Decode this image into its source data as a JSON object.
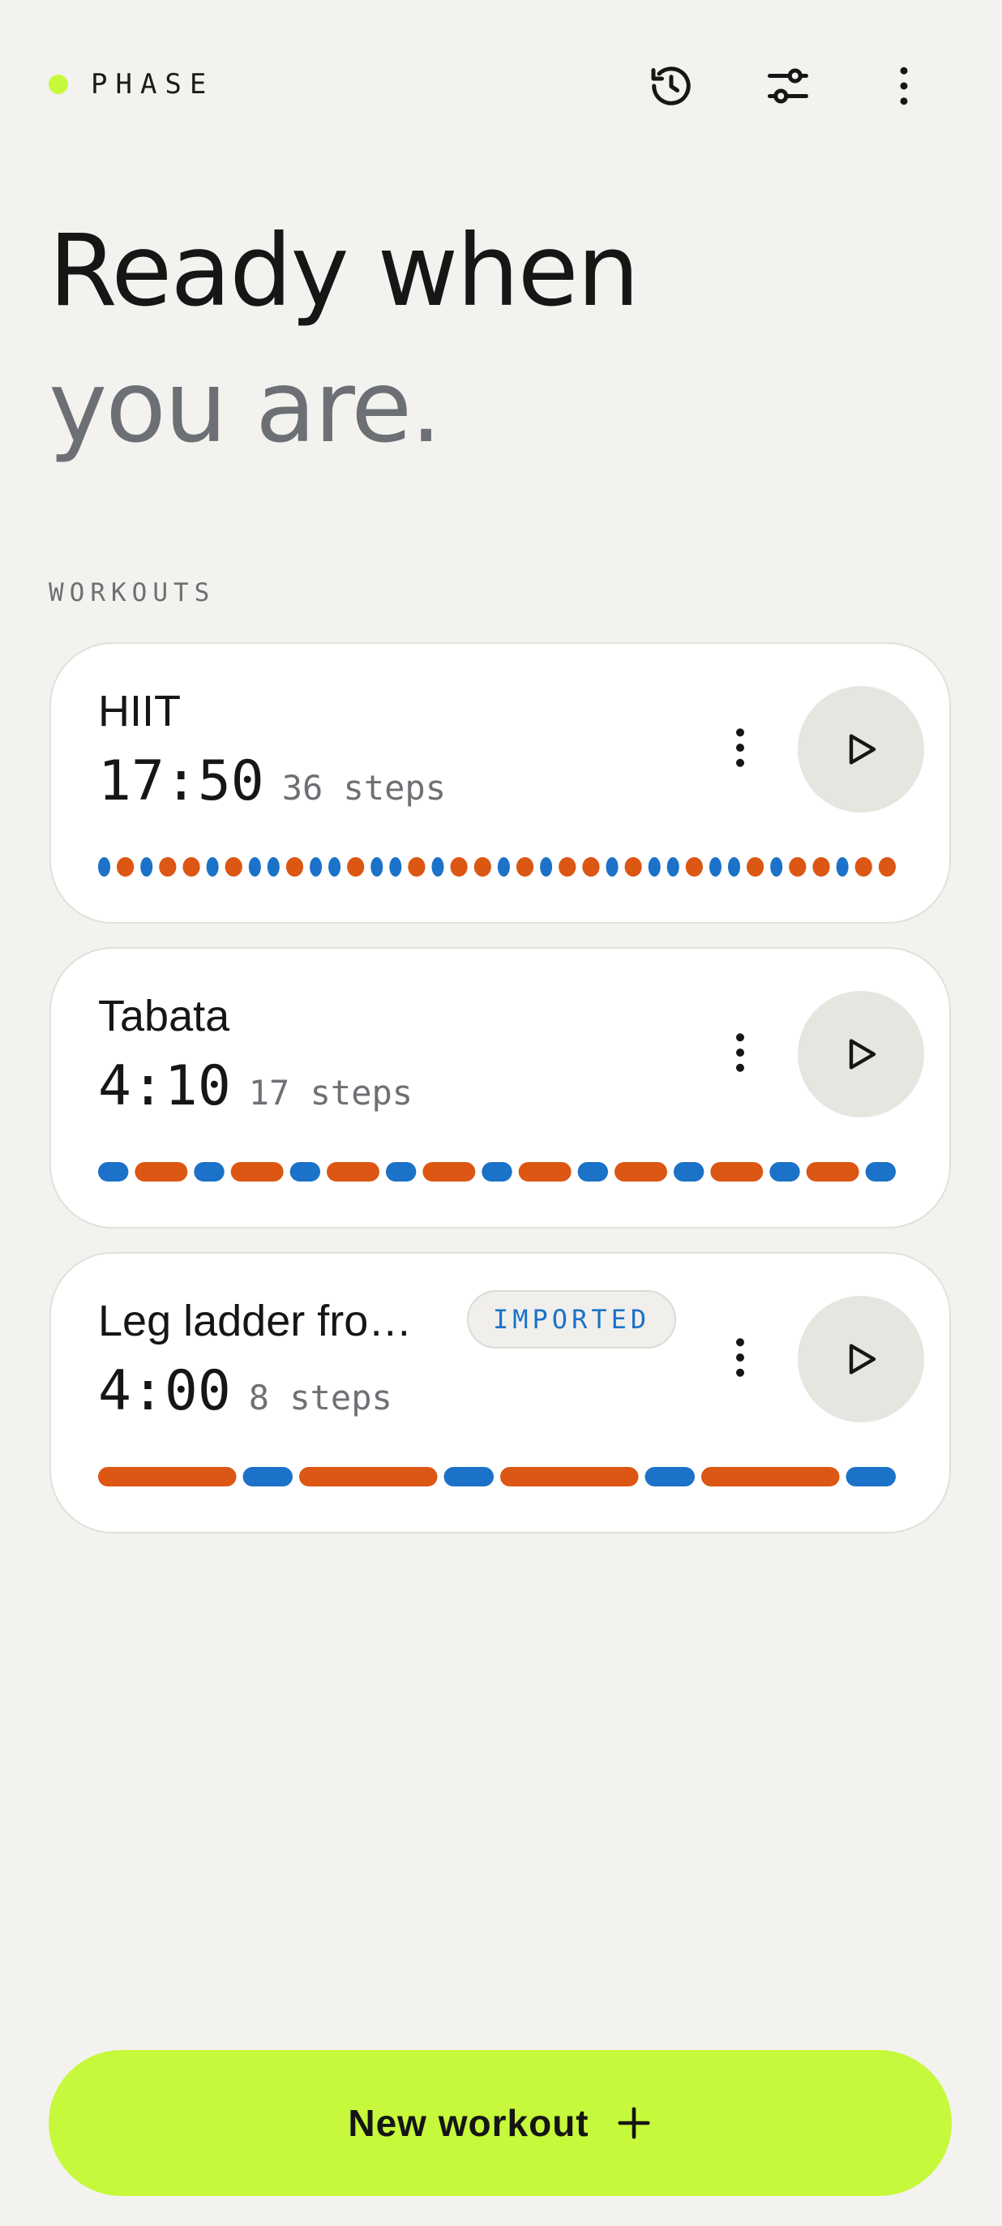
{
  "app": {
    "brand": "PHASE",
    "brand_color": "#c6f93b"
  },
  "header_icons": [
    "history-icon",
    "sliders-icon",
    "more-vertical-icon"
  ],
  "hero": {
    "line1": "Ready when",
    "line2": "you are."
  },
  "section": {
    "label": "WORKOUTS"
  },
  "colors": {
    "work": "#dc5614",
    "rest": "#1b72c8",
    "accent": "#c6f93b"
  },
  "workouts": [
    {
      "title": "HIIT",
      "time": "17:50",
      "steps": "36 steps",
      "badge": "",
      "segments": [
        "rest",
        "work",
        "rest",
        "work",
        "work",
        "rest",
        "work",
        "rest",
        "rest",
        "work",
        "rest",
        "rest",
        "work",
        "rest",
        "rest",
        "work",
        "rest",
        "work",
        "work",
        "rest",
        "work",
        "rest",
        "work",
        "work",
        "rest",
        "work",
        "rest",
        "rest",
        "work",
        "rest",
        "rest",
        "work",
        "rest",
        "work",
        "work",
        "rest",
        "work",
        "work"
      ]
    },
    {
      "title": "Tabata",
      "time": "4:10",
      "steps": "17 steps",
      "badge": "",
      "segments": [
        "rest",
        "work",
        "rest",
        "work",
        "rest",
        "work",
        "rest",
        "work",
        "rest",
        "work",
        "rest",
        "work",
        "rest",
        "work",
        "rest",
        "work",
        "rest"
      ]
    },
    {
      "title": "Leg ladder fro…",
      "time": "4:00",
      "steps": "8 steps",
      "badge": "IMPORTED",
      "segments": [
        "work",
        "rest",
        "work",
        "rest",
        "work",
        "rest",
        "work",
        "rest"
      ]
    }
  ],
  "new_workout": {
    "label": "New workout"
  }
}
